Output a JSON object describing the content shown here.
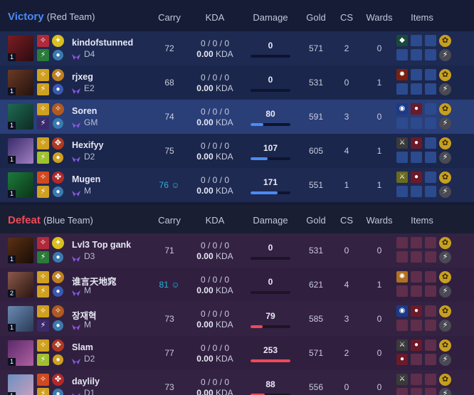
{
  "columns": {
    "carry": "Carry",
    "kda": "KDA",
    "damage": "Damage",
    "gold": "Gold",
    "cs": "CS",
    "wards": "Wards",
    "items": "Items"
  },
  "colors": {
    "victory_accent": "#4c8af5",
    "defeat_accent": "#ef4a55",
    "top_carry": "#2ab1d6"
  },
  "victory": {
    "result": "Victory",
    "team": "(Red Team)",
    "players": [
      {
        "name": "kindofstunned",
        "rank": "D4",
        "level": "1",
        "carry": "72",
        "kda_line": "0 / 0 / 0",
        "kda_ratio": "0.00",
        "kda_label": "KDA",
        "damage": "0",
        "damage_fraction": 0.0,
        "gold": "571",
        "cs": "2",
        "wards": "0"
      },
      {
        "name": "rjxeg",
        "rank": "E2",
        "level": "1",
        "carry": "68",
        "kda_line": "0 / 0 / 0",
        "kda_ratio": "0.00",
        "kda_label": "KDA",
        "damage": "0",
        "damage_fraction": 0.0,
        "gold": "531",
        "cs": "0",
        "wards": "1"
      },
      {
        "name": "Soren",
        "rank": "GM",
        "level": "1",
        "carry": "74",
        "kda_line": "0 / 0 / 0",
        "kda_ratio": "0.00",
        "kda_label": "KDA",
        "damage": "80",
        "damage_fraction": 0.32,
        "gold": "591",
        "cs": "3",
        "wards": "0"
      },
      {
        "name": "Hexifyy",
        "rank": "D2",
        "level": "1",
        "carry": "75",
        "kda_line": "0 / 0 / 0",
        "kda_ratio": "0.00",
        "kda_label": "KDA",
        "damage": "107",
        "damage_fraction": 0.42,
        "gold": "605",
        "cs": "4",
        "wards": "1"
      },
      {
        "name": "Mugen",
        "rank": "M",
        "level": "1",
        "carry": "76",
        "carry_top": true,
        "kda_line": "0 / 0 / 0",
        "kda_ratio": "0.00",
        "kda_label": "KDA",
        "damage": "171",
        "damage_fraction": 0.68,
        "gold": "551",
        "cs": "1",
        "wards": "1"
      }
    ]
  },
  "defeat": {
    "result": "Defeat",
    "team": "(Blue Team)",
    "players": [
      {
        "name": "Lvl3 Top gank",
        "rank": "D3",
        "level": "1",
        "carry": "71",
        "kda_line": "0 / 0 / 0",
        "kda_ratio": "0.00",
        "kda_label": "KDA",
        "damage": "0",
        "damage_fraction": 0.0,
        "gold": "531",
        "cs": "0",
        "wards": "0"
      },
      {
        "name": "谁言天地窕",
        "rank": "M",
        "level": "2",
        "carry": "81",
        "carry_top": true,
        "kda_line": "0 / 0 / 0",
        "kda_ratio": "0.00",
        "kda_label": "KDA",
        "damage": "0",
        "damage_fraction": 0.0,
        "gold": "621",
        "cs": "4",
        "wards": "1"
      },
      {
        "name": "장재혁",
        "rank": "M",
        "level": "1",
        "carry": "73",
        "kda_line": "0 / 0 / 0",
        "kda_ratio": "0.00",
        "kda_label": "KDA",
        "damage": "79",
        "damage_fraction": 0.31,
        "gold": "585",
        "cs": "3",
        "wards": "0"
      },
      {
        "name": "Slam",
        "rank": "D2",
        "level": "1",
        "carry": "77",
        "kda_line": "0 / 0 / 0",
        "kda_ratio": "0.00",
        "kda_label": "KDA",
        "damage": "253",
        "damage_fraction": 1.0,
        "gold": "571",
        "cs": "2",
        "wards": "0"
      },
      {
        "name": "daylily",
        "rank": "D1",
        "level": "1",
        "carry": "73",
        "kda_line": "0 / 0 / 0",
        "kda_ratio": "0.00",
        "kda_label": "KDA",
        "damage": "88",
        "damage_fraction": 0.35,
        "gold": "556",
        "cs": "0",
        "wards": "0"
      }
    ]
  }
}
